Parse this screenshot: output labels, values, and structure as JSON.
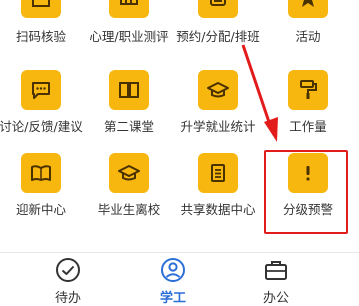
{
  "grid": {
    "row0": [
      "扫码核验",
      "心理/职业测评",
      "预约/分配/排班",
      "活动"
    ],
    "row1": [
      "讨论/反馈/建议",
      "第二课堂",
      "升学就业统计",
      "工作量"
    ],
    "row2": [
      "迎新中心",
      "毕业生离校",
      "共享数据中心",
      "分级预警"
    ]
  },
  "tabbar": {
    "tabs": [
      {
        "label": "待办"
      },
      {
        "label": "学工"
      },
      {
        "label": "办公"
      }
    ]
  },
  "colors": {
    "tile": "#f7b70f",
    "active_tab": "#2c6fd6",
    "highlight": "#e21b1b"
  }
}
